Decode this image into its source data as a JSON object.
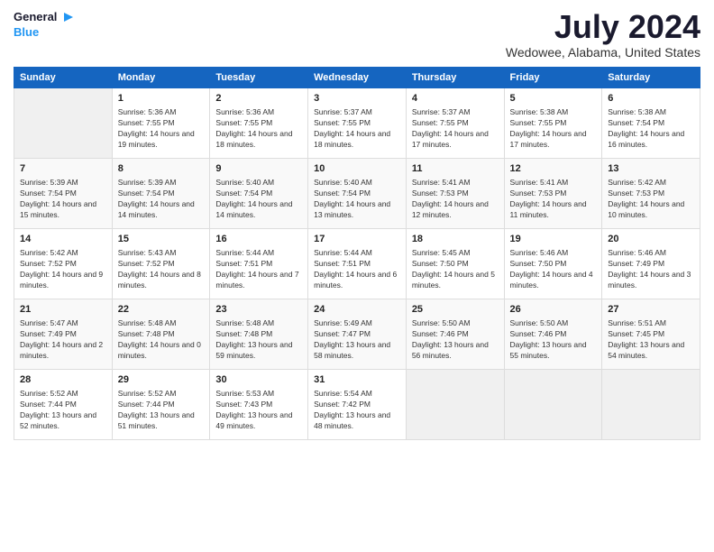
{
  "header": {
    "logo_line1": "General",
    "logo_line2": "Blue",
    "main_title": "July 2024",
    "subtitle": "Wedowee, Alabama, United States"
  },
  "days_of_week": [
    "Sunday",
    "Monday",
    "Tuesday",
    "Wednesday",
    "Thursday",
    "Friday",
    "Saturday"
  ],
  "weeks": [
    [
      {
        "num": "",
        "empty": true
      },
      {
        "num": "1",
        "rise": "5:36 AM",
        "set": "7:55 PM",
        "daylight": "14 hours and 19 minutes."
      },
      {
        "num": "2",
        "rise": "5:36 AM",
        "set": "7:55 PM",
        "daylight": "14 hours and 18 minutes."
      },
      {
        "num": "3",
        "rise": "5:37 AM",
        "set": "7:55 PM",
        "daylight": "14 hours and 18 minutes."
      },
      {
        "num": "4",
        "rise": "5:37 AM",
        "set": "7:55 PM",
        "daylight": "14 hours and 17 minutes."
      },
      {
        "num": "5",
        "rise": "5:38 AM",
        "set": "7:55 PM",
        "daylight": "14 hours and 17 minutes."
      },
      {
        "num": "6",
        "rise": "5:38 AM",
        "set": "7:54 PM",
        "daylight": "14 hours and 16 minutes."
      }
    ],
    [
      {
        "num": "7",
        "rise": "5:39 AM",
        "set": "7:54 PM",
        "daylight": "14 hours and 15 minutes."
      },
      {
        "num": "8",
        "rise": "5:39 AM",
        "set": "7:54 PM",
        "daylight": "14 hours and 14 minutes."
      },
      {
        "num": "9",
        "rise": "5:40 AM",
        "set": "7:54 PM",
        "daylight": "14 hours and 14 minutes."
      },
      {
        "num": "10",
        "rise": "5:40 AM",
        "set": "7:54 PM",
        "daylight": "14 hours and 13 minutes."
      },
      {
        "num": "11",
        "rise": "5:41 AM",
        "set": "7:53 PM",
        "daylight": "14 hours and 12 minutes."
      },
      {
        "num": "12",
        "rise": "5:41 AM",
        "set": "7:53 PM",
        "daylight": "14 hours and 11 minutes."
      },
      {
        "num": "13",
        "rise": "5:42 AM",
        "set": "7:53 PM",
        "daylight": "14 hours and 10 minutes."
      }
    ],
    [
      {
        "num": "14",
        "rise": "5:42 AM",
        "set": "7:52 PM",
        "daylight": "14 hours and 9 minutes."
      },
      {
        "num": "15",
        "rise": "5:43 AM",
        "set": "7:52 PM",
        "daylight": "14 hours and 8 minutes."
      },
      {
        "num": "16",
        "rise": "5:44 AM",
        "set": "7:51 PM",
        "daylight": "14 hours and 7 minutes."
      },
      {
        "num": "17",
        "rise": "5:44 AM",
        "set": "7:51 PM",
        "daylight": "14 hours and 6 minutes."
      },
      {
        "num": "18",
        "rise": "5:45 AM",
        "set": "7:50 PM",
        "daylight": "14 hours and 5 minutes."
      },
      {
        "num": "19",
        "rise": "5:46 AM",
        "set": "7:50 PM",
        "daylight": "14 hours and 4 minutes."
      },
      {
        "num": "20",
        "rise": "5:46 AM",
        "set": "7:49 PM",
        "daylight": "14 hours and 3 minutes."
      }
    ],
    [
      {
        "num": "21",
        "rise": "5:47 AM",
        "set": "7:49 PM",
        "daylight": "14 hours and 2 minutes."
      },
      {
        "num": "22",
        "rise": "5:48 AM",
        "set": "7:48 PM",
        "daylight": "14 hours and 0 minutes."
      },
      {
        "num": "23",
        "rise": "5:48 AM",
        "set": "7:48 PM",
        "daylight": "13 hours and 59 minutes."
      },
      {
        "num": "24",
        "rise": "5:49 AM",
        "set": "7:47 PM",
        "daylight": "13 hours and 58 minutes."
      },
      {
        "num": "25",
        "rise": "5:50 AM",
        "set": "7:46 PM",
        "daylight": "13 hours and 56 minutes."
      },
      {
        "num": "26",
        "rise": "5:50 AM",
        "set": "7:46 PM",
        "daylight": "13 hours and 55 minutes."
      },
      {
        "num": "27",
        "rise": "5:51 AM",
        "set": "7:45 PM",
        "daylight": "13 hours and 54 minutes."
      }
    ],
    [
      {
        "num": "28",
        "rise": "5:52 AM",
        "set": "7:44 PM",
        "daylight": "13 hours and 52 minutes."
      },
      {
        "num": "29",
        "rise": "5:52 AM",
        "set": "7:44 PM",
        "daylight": "13 hours and 51 minutes."
      },
      {
        "num": "30",
        "rise": "5:53 AM",
        "set": "7:43 PM",
        "daylight": "13 hours and 49 minutes."
      },
      {
        "num": "31",
        "rise": "5:54 AM",
        "set": "7:42 PM",
        "daylight": "13 hours and 48 minutes."
      },
      {
        "num": "",
        "empty": true
      },
      {
        "num": "",
        "empty": true
      },
      {
        "num": "",
        "empty": true
      }
    ]
  ]
}
